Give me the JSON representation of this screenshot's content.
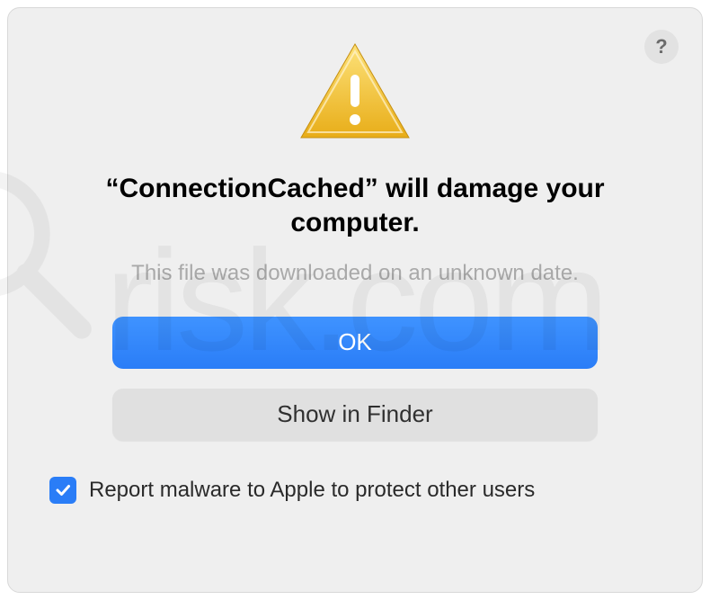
{
  "dialog": {
    "help_label": "?",
    "title": "“ConnectionCached” will damage your computer.",
    "subtitle": "This file was downloaded on an unknown date.",
    "ok_label": "OK",
    "show_in_finder_label": "Show in Finder",
    "checkbox_label": "Report malware to Apple to protect other users",
    "checkbox_checked": true
  },
  "colors": {
    "primary": "#2a7df7",
    "background": "#efefef"
  },
  "watermark": {
    "text": "risk.com"
  }
}
